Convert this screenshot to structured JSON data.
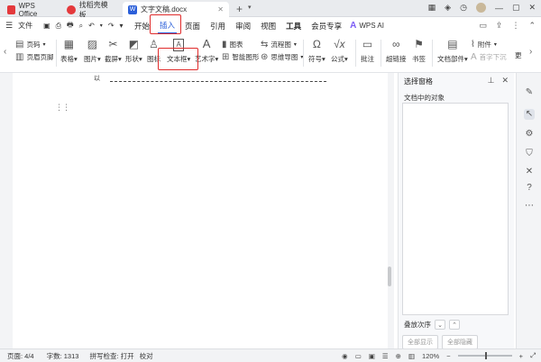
{
  "tabs": {
    "wps_office": "WPS Office",
    "template": "找稻壳模板",
    "document": "文字文稿.docx",
    "new_tab": "+"
  },
  "menu": {
    "file": "文件",
    "tabs": [
      "开始",
      "插入",
      "页面",
      "引用",
      "审阅",
      "视图",
      "工具",
      "会员专享"
    ],
    "active_tab": "插入",
    "ai_label": "WPS AI"
  },
  "ribbon": {
    "page_break": "页码",
    "header_footer": "页眉页脚",
    "table": "表格",
    "image": "图片",
    "screenshot": "截屏",
    "shape": "形状",
    "icon": "图标",
    "textbox": "文本框",
    "wordart": "艺术字",
    "chart": "图表",
    "smart_graphic": "智能图形",
    "flowchart": "流程图",
    "mindmap": "思维导图",
    "symbol": "符号",
    "formula": "公式",
    "comment": "批注",
    "hyperlink": "超链接",
    "bookmark": "书签",
    "attachment": "附件",
    "doc_parts": "文档部件",
    "first_letter_drop": "首字下沉",
    "more": "更"
  },
  "document": {
    "stray_char": "以"
  },
  "pane": {
    "title": "选择窗格",
    "subtitle": "文档中的对象",
    "order_label": "叠放次序",
    "show_all": "全部显示",
    "hide_all": "全部隐藏"
  },
  "status": {
    "page": "页面: 4/4",
    "words": "字数: 1313",
    "spell": "拼写检查: 打开",
    "proof": "校对",
    "zoom": "120%"
  },
  "colors": {
    "accent": "#2b5fd9",
    "highlight_box": "#e02b2b",
    "wps_red": "#e4393c"
  }
}
